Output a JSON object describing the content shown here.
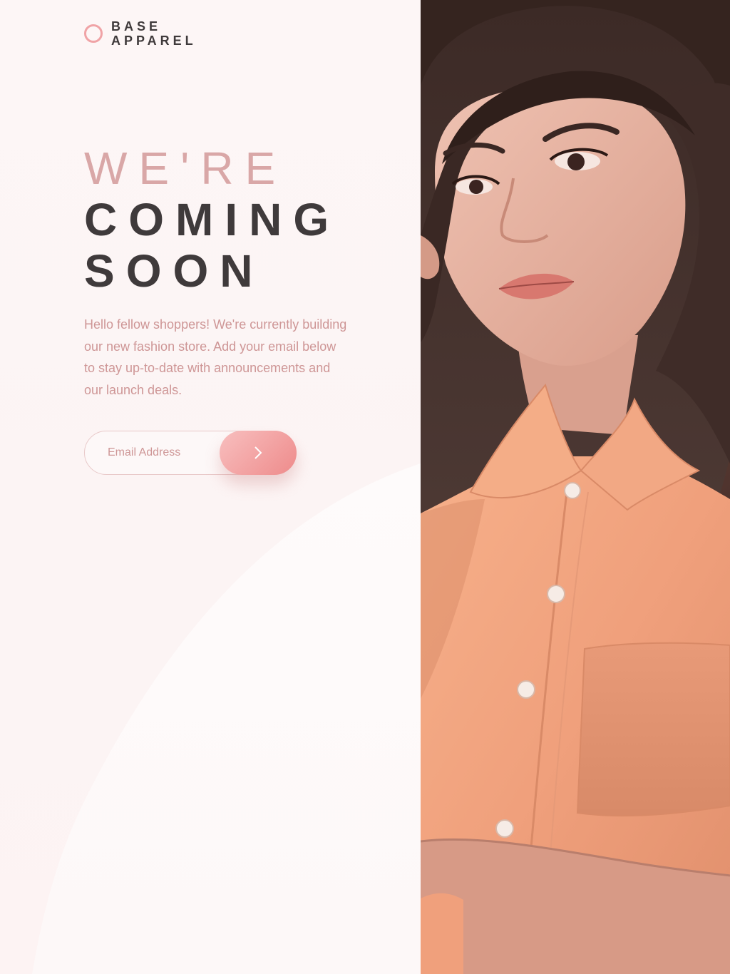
{
  "brand": {
    "line1": "BASE",
    "line2": "APPAREL",
    "accent_color": "#f0a3a6",
    "text_color": "#3f3a3b"
  },
  "headline": {
    "line1": "WE'RE",
    "line2": "COMING",
    "line3": "SOON",
    "light_color": "#d9a7a7",
    "dark_color": "#3f3a3b"
  },
  "intro": {
    "text": "Hello fellow shoppers! We're currently building our new fashion store. Add your email below to stay up-to-date with announcements and our launch deals.",
    "color": "#ce9696"
  },
  "signup": {
    "email_placeholder": "Email Address",
    "email_value": "",
    "submit_icon": "chevron-right-icon",
    "button_gradient": [
      "#f8bfbf",
      "#ee8b8b"
    ]
  },
  "hero": {
    "subject": "woman-in-orange-shirt",
    "shirt_color": "#f0a07c",
    "hair_color": "#3a2824"
  }
}
